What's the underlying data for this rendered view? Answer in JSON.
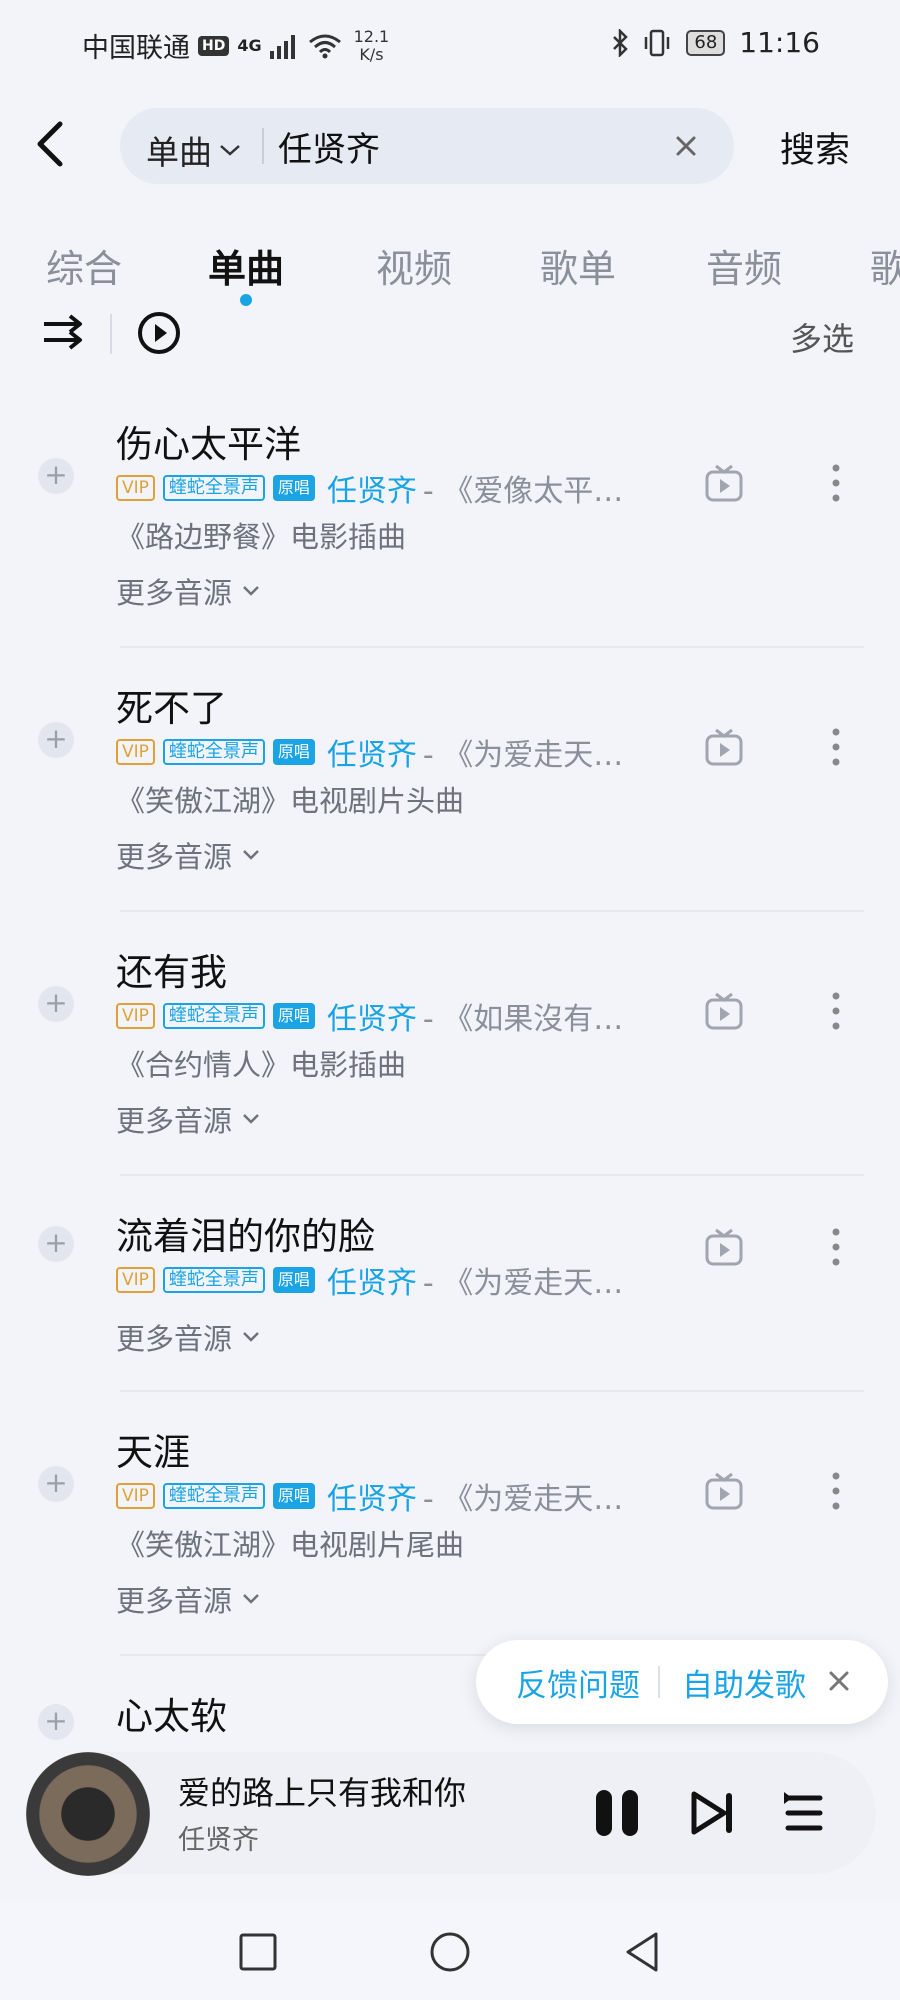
{
  "status_bar": {
    "carrier": "中国联通",
    "hd": "HD",
    "network": "4G",
    "speed_value": "12.1",
    "speed_unit": "K/s",
    "battery": "68",
    "time": "11:16"
  },
  "search": {
    "type_label": "单曲",
    "query": "任贤齐",
    "button_label": "搜索"
  },
  "tabs": [
    {
      "label": "综合"
    },
    {
      "label": "单曲"
    },
    {
      "label": "视频"
    },
    {
      "label": "歌单"
    },
    {
      "label": "音频"
    },
    {
      "label": "歌"
    }
  ],
  "active_tab": 1,
  "toolbar": {
    "multi_select_label": "多选"
  },
  "songs": [
    {
      "title": "伤心太平洋",
      "vip": "VIP",
      "sound_tag": "蝰蛇全景声",
      "orig_tag": "原唱",
      "artist": "任贤齐",
      "album": " - 《爱像太平…",
      "desc": "《路边野餐》电影插曲",
      "more": "更多音源"
    },
    {
      "title": "死不了",
      "vip": "VIP",
      "sound_tag": "蝰蛇全景声",
      "orig_tag": "原唱",
      "artist": "任贤齐",
      "album": " - 《为爱走天…",
      "desc": "《笑傲江湖》电视剧片头曲",
      "more": "更多音源"
    },
    {
      "title": "还有我",
      "vip": "VIP",
      "sound_tag": "蝰蛇全景声",
      "orig_tag": "原唱",
      "artist": "任贤齐",
      "album": " - 《如果沒有…",
      "desc": "《合约情人》电影插曲",
      "more": "更多音源"
    },
    {
      "title": "流着泪的你的脸",
      "vip": "VIP",
      "sound_tag": "蝰蛇全景声",
      "orig_tag": "原唱",
      "artist": "任贤齐",
      "album": " - 《为爱走天…",
      "desc": "",
      "more": "更多音源"
    },
    {
      "title": "天涯",
      "vip": "VIP",
      "sound_tag": "蝰蛇全景声",
      "orig_tag": "原唱",
      "artist": "任贤齐",
      "album": " - 《为爱走天…",
      "desc": "《笑傲江湖》电视剧片尾曲",
      "more": "更多音源"
    },
    {
      "title": "心太软",
      "vip": "",
      "sound_tag": "",
      "orig_tag": "",
      "artist": "",
      "album": "",
      "desc": "",
      "more": ""
    }
  ],
  "feedback": {
    "report_label": "反馈问题",
    "publish_label": "自助发歌"
  },
  "player": {
    "title": "爱的路上只有我和你",
    "artist": "任贤齐"
  },
  "colors": {
    "accent": "#1aa4e6",
    "vip": "#e0a236",
    "background": "#f2f4fa"
  }
}
